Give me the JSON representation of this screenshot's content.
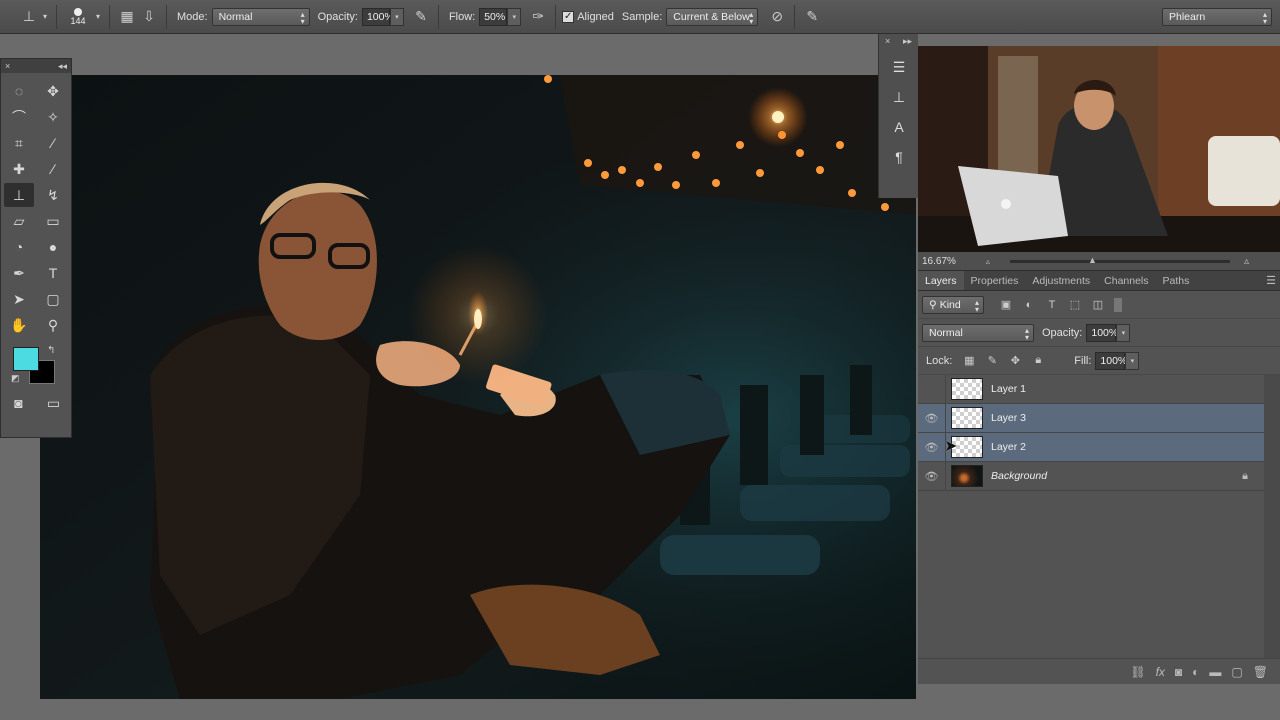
{
  "options_bar": {
    "brush_size": "144",
    "mode_label": "Mode:",
    "mode_value": "Normal",
    "opacity_label": "Opacity:",
    "opacity_value": "100%",
    "flow_label": "Flow:",
    "flow_value": "50%",
    "aligned_label": "Aligned",
    "aligned_checked": true,
    "sample_label": "Sample:",
    "sample_value": "Current & Below",
    "workspace": "Phlearn"
  },
  "tools": {
    "items": [
      {
        "name": "marquee",
        "glyph": "◌"
      },
      {
        "name": "move",
        "glyph": "✥"
      },
      {
        "name": "lasso",
        "glyph": "⌒"
      },
      {
        "name": "quick-select",
        "glyph": "✧"
      },
      {
        "name": "crop",
        "glyph": "⌗"
      },
      {
        "name": "eyedropper",
        "glyph": "⁄"
      },
      {
        "name": "healing",
        "glyph": "✚"
      },
      {
        "name": "brush",
        "glyph": "∕"
      },
      {
        "name": "clone-stamp",
        "glyph": "⊥",
        "active": true
      },
      {
        "name": "history-brush",
        "glyph": "↯"
      },
      {
        "name": "eraser",
        "glyph": "▱"
      },
      {
        "name": "gradient",
        "glyph": "▭"
      },
      {
        "name": "blur",
        "glyph": "◔"
      },
      {
        "name": "dodge",
        "glyph": "●"
      },
      {
        "name": "pen",
        "glyph": "✒"
      },
      {
        "name": "type",
        "glyph": "T"
      },
      {
        "name": "path-select",
        "glyph": "➤"
      },
      {
        "name": "shape",
        "glyph": "▢"
      },
      {
        "name": "hand",
        "glyph": "✋"
      },
      {
        "name": "zoom",
        "glyph": "⚲"
      }
    ],
    "fg_color": "#4bdbe0",
    "bg_color": "#000000"
  },
  "navigator": {
    "zoom": "16.67%"
  },
  "layers_panel": {
    "tabs": [
      "Layers",
      "Properties",
      "Adjustments",
      "Channels",
      "Paths"
    ],
    "active_tab": "Layers",
    "filter_kind": "Kind",
    "blend_mode": "Normal",
    "opacity_label": "Opacity:",
    "opacity_value": "100%",
    "lock_label": "Lock:",
    "fill_label": "Fill:",
    "fill_value": "100%",
    "layers": [
      {
        "name": "Layer 1",
        "visible": false,
        "selected": false
      },
      {
        "name": "Layer 3",
        "visible": true,
        "selected": true
      },
      {
        "name": "Layer 2",
        "visible": true,
        "selected": true
      },
      {
        "name": "Background",
        "visible": true,
        "selected": false,
        "locked": true
      }
    ]
  }
}
